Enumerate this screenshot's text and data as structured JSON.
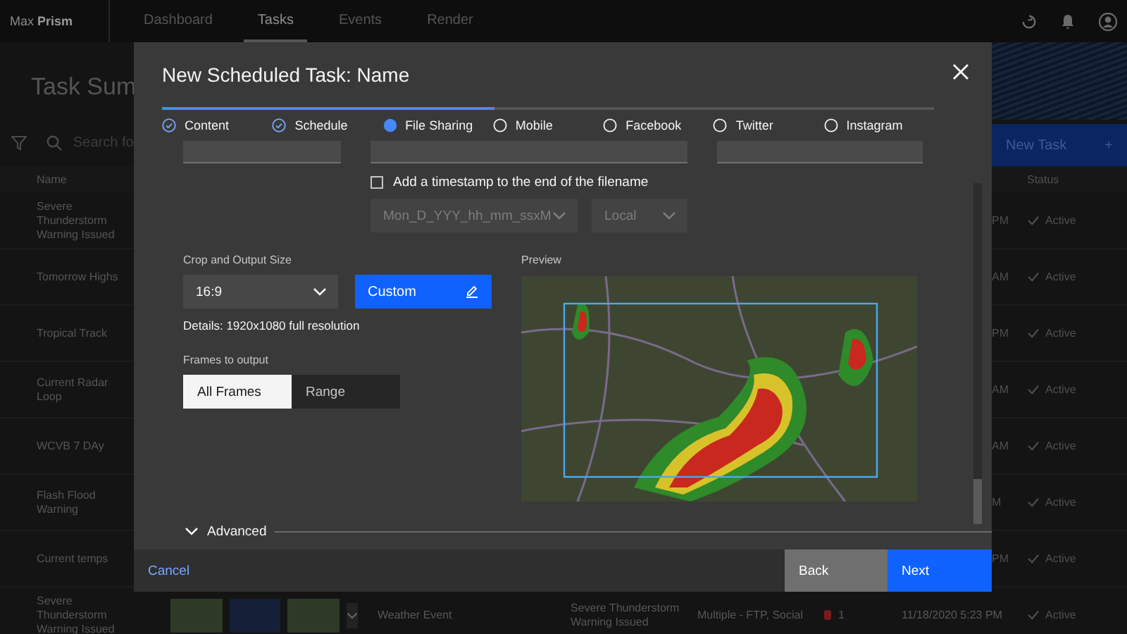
{
  "app_bar": {
    "brand": "Max **Prism**",
    "nav": [
      {
        "label": "Dashboard",
        "selected": false
      },
      {
        "label": "Tasks",
        "selected": true
      },
      {
        "label": "Events",
        "selected": false
      },
      {
        "label": "Render",
        "selected": false
      }
    ]
  },
  "page": {
    "title": "Task Sum",
    "search": {
      "placeholder": "Search fo"
    },
    "new_task_button": {
      "label": "New Task",
      "icon": "+"
    }
  },
  "table": {
    "columns": [
      "Name",
      "Status"
    ],
    "rows": [
      {
        "name": "Severe Thunderstorm Warning Issued",
        "time": "PM",
        "status": "Active"
      },
      {
        "name": "Tomorrow Highs",
        "time": "AM",
        "status": "Active"
      },
      {
        "name": "Tropical Track",
        "time": "PM",
        "status": "Active"
      },
      {
        "name": "Current Radar Loop",
        "time": "AM",
        "status": "Active"
      },
      {
        "name": "WCVB 7 DAy",
        "time": "AM",
        "status": "Active"
      },
      {
        "name": "Flash Flood Warning",
        "time": "M",
        "status": "Active"
      },
      {
        "name": "Current temps",
        "time": "PM",
        "status": "Active"
      },
      {
        "name": "Severe Thunderstorm Warning Issued",
        "trigger": "Weather Event",
        "event": "Severe Thunderstorm Warning Issued",
        "destinations": "Multiple - FTP, Social",
        "alerts": "1",
        "time": "11/18/2020 5:23 PM",
        "status": "Active"
      }
    ]
  },
  "modal": {
    "title": "New Scheduled Task: Name",
    "progress": {
      "level": 0.43
    },
    "steps": [
      {
        "label": "Content",
        "complete": true,
        "current": false
      },
      {
        "label": "Schedule",
        "complete": true,
        "current": false
      },
      {
        "label": "File Sharing",
        "complete": false,
        "current": true
      },
      {
        "label": "Mobile",
        "complete": false,
        "current": false
      },
      {
        "label": "Facebook",
        "complete": false,
        "current": false
      },
      {
        "label": "Twitter",
        "complete": false,
        "current": false
      },
      {
        "label": "Instagram",
        "complete": false,
        "current": false
      }
    ],
    "timestamp": {
      "label": "Add a timestamp to the end of the filename",
      "checked": false
    },
    "format_dropdown": {
      "value": "Mon_D_YYY_hh_mm_ssxM",
      "disabled": true
    },
    "timezone_dropdown": {
      "value": "Local",
      "disabled": true
    },
    "crop": {
      "label": "Crop and Output Size",
      "value": "16:9",
      "custom_button": "Custom",
      "details": "Details: 1920x1080 full resolution"
    },
    "frames": {
      "label": "Frames to output",
      "options": [
        {
          "label": "All Frames",
          "selected": true
        },
        {
          "label": "Range",
          "selected": false
        }
      ]
    },
    "preview": {
      "label": "Preview"
    },
    "advanced": {
      "label": "Advanced",
      "expanded": false
    },
    "buttons": {
      "cancel": "Cancel",
      "back": "Back",
      "next": "Next"
    }
  }
}
